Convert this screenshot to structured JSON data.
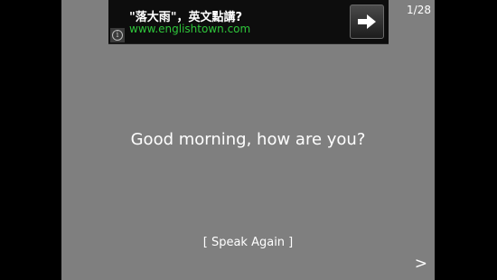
{
  "ad": {
    "title": "\"落大雨\"，英文點講?",
    "url": "www.englishtown.com",
    "info_icon": "info-icon",
    "arrow_icon": "arrow-right-icon"
  },
  "counter": "1/28",
  "phrase": "Good morning, how are you?",
  "speak_again_label": "[ Speak Again ]",
  "next_label": ">",
  "colors": {
    "background": "#7f7f7f",
    "letterbox": "#000000",
    "ad_url": "#2ec53a"
  }
}
